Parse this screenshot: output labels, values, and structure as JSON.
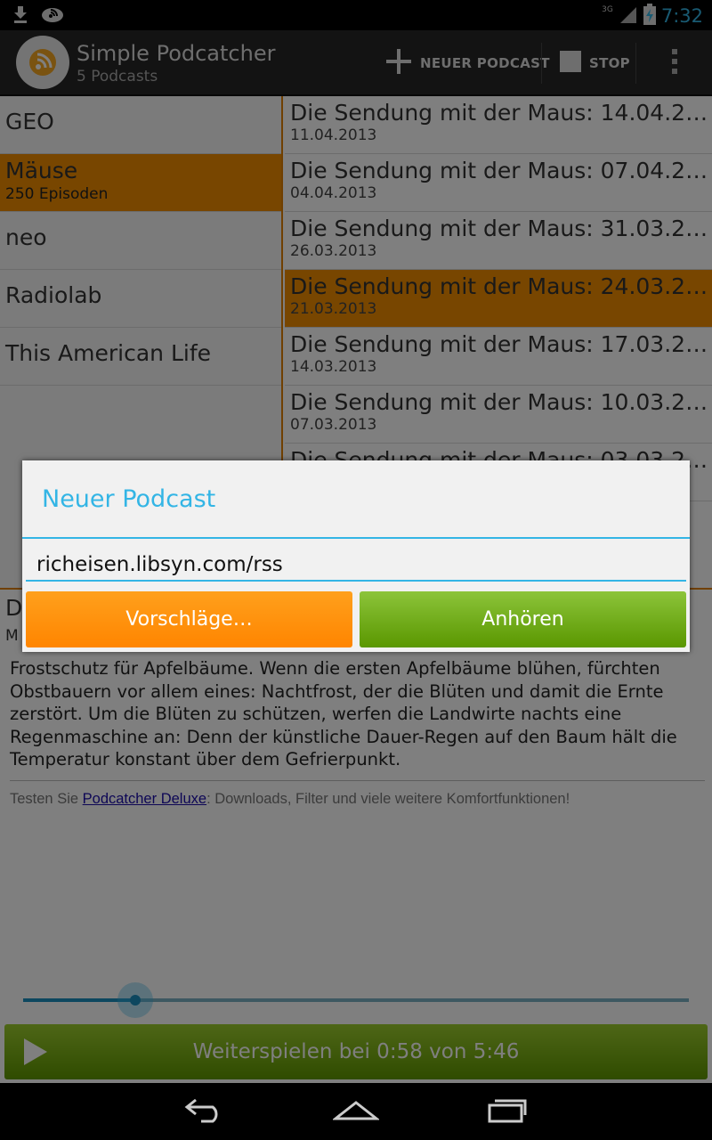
{
  "status_bar": {
    "time": "7:32",
    "network": "3G"
  },
  "action_bar": {
    "title": "Simple Podcatcher",
    "subtitle": "5 Podcasts",
    "new_podcast_label": "NEUER PODCAST",
    "stop_label": "STOP"
  },
  "podcasts": [
    {
      "name": "GEO",
      "count": ""
    },
    {
      "name": "Mäuse",
      "count": "250 Episoden",
      "selected": true
    },
    {
      "name": "neo",
      "count": ""
    },
    {
      "name": "Radiolab",
      "count": ""
    },
    {
      "name": "This American Life",
      "count": ""
    }
  ],
  "episodes": [
    {
      "title": "Die Sendung mit der Maus: 14.04.201…",
      "date": "11.04.2013"
    },
    {
      "title": "Die Sendung mit der Maus: 07.04.201…",
      "date": "04.04.2013"
    },
    {
      "title": "Die Sendung mit der Maus: 31.03.201…",
      "date": "26.03.2013"
    },
    {
      "title": "Die Sendung mit der Maus: 24.03.201…",
      "date": "21.03.2013",
      "selected": true
    },
    {
      "title": "Die Sendung mit der Maus: 17.03.201…",
      "date": "14.03.2013"
    },
    {
      "title": "Die Sendung mit der Maus: 10.03.201…",
      "date": "07.03.2013"
    },
    {
      "title": "Die Sendung mit der Maus: 03.03.201…",
      "date": ""
    }
  ],
  "detail": {
    "title": "D",
    "subtitle": "M",
    "description": "Frostschutz für Apfelbäume. Wenn die ersten Apfelbäume blühen, fürchten Obstbauern vor allem eines: Nachtfrost, der die Blüten und damit die Ernte zerstört. Um die Blüten zu schützen, werfen die Landwirte nachts eine Regenmaschine an: Denn der künstliche Dauer-Regen auf den Baum hält die Temperatur konstant über dem Gefrierpunkt.",
    "promo_prefix": "Testen Sie ",
    "promo_link": "Podcatcher Deluxe",
    "promo_suffix": ": Downloads, Filter und viele weitere Komfortfunktionen!"
  },
  "player": {
    "progress_fraction": 0.168,
    "play_label": "Weiterspielen bei 0:58 von 5:46"
  },
  "dialog": {
    "title": "Neuer Podcast",
    "url_value": "richeisen.libsyn.com/rss",
    "suggestions_label": "Vorschläge…",
    "listen_label": "Anhören"
  },
  "colors": {
    "accent_blue": "#33b5e5",
    "orange": "#f08c00",
    "green": "#6aa70c"
  }
}
